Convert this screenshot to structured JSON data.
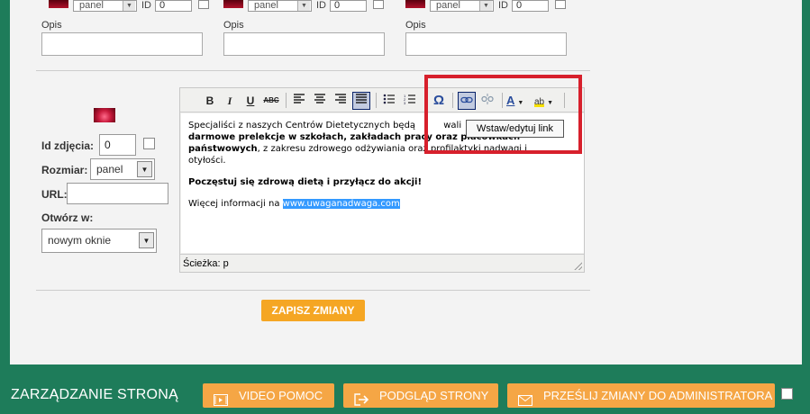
{
  "top_rows": [
    {
      "select": "panel",
      "id_label": "ID",
      "id_value": "0"
    },
    {
      "select": "panel",
      "id_label": "ID",
      "id_value": "0"
    },
    {
      "select": "panel",
      "id_label": "ID",
      "id_value": "0"
    }
  ],
  "opis_label": "Opis",
  "form": {
    "id_label": "Id zdjęcia:",
    "id_value": "0",
    "size_label": "Rozmiar:",
    "size_value": "panel",
    "url_label": "URL:",
    "url_value": "",
    "open_label": "Otwórz w:",
    "open_value": "nowym oknie"
  },
  "editor": {
    "toolbar_icons": [
      "bold-icon",
      "italic-icon",
      "underline-icon",
      "strikethrough-icon",
      "align-left-icon",
      "align-center-icon",
      "align-right-icon",
      "align-justify-icon",
      "bullet-list-icon",
      "numbered-list-icon",
      "special-char-icon",
      "link-icon",
      "unlink-icon",
      "text-color-icon",
      "highlight-color-icon"
    ],
    "para1_a": "Specjaliści z naszych Centrów Dietetycznych będą",
    "para1_a_tail": "wali",
    "para1_b_bold": "darmowe prelekcje w szkołach, zakładach pracy oraz placówkach",
    "para1_c_bold": "państwowych",
    "para1_c": ", z zakresu zdrowego odżywiania oraz profilaktyki nadwagi i",
    "para1_d": "otyłości.",
    "para2_bold": "Poczęstuj się zdrową dietą i przyłącz do akcji!",
    "para3": "Więcej informacji na ",
    "para3_link": "www.uwaganadwaga.com",
    "status": "Ścieżka: p",
    "tooltip": "Wstaw/edytuj link"
  },
  "save_button": "ZAPISZ ZMIANY",
  "footer": {
    "title": "ZARZĄDZANIE STRONĄ",
    "video_help": "VIDEO POMOC",
    "preview": "PODGLĄD STRONY",
    "send_changes": "PRZEŚLIJ ZMIANY DO ADMINISTRATORA"
  },
  "colors": {
    "background_green": "#1e7c5a",
    "accent_orange": "#f5a623",
    "highlight_red": "#d7202c",
    "selection_blue": "#3399ff"
  }
}
